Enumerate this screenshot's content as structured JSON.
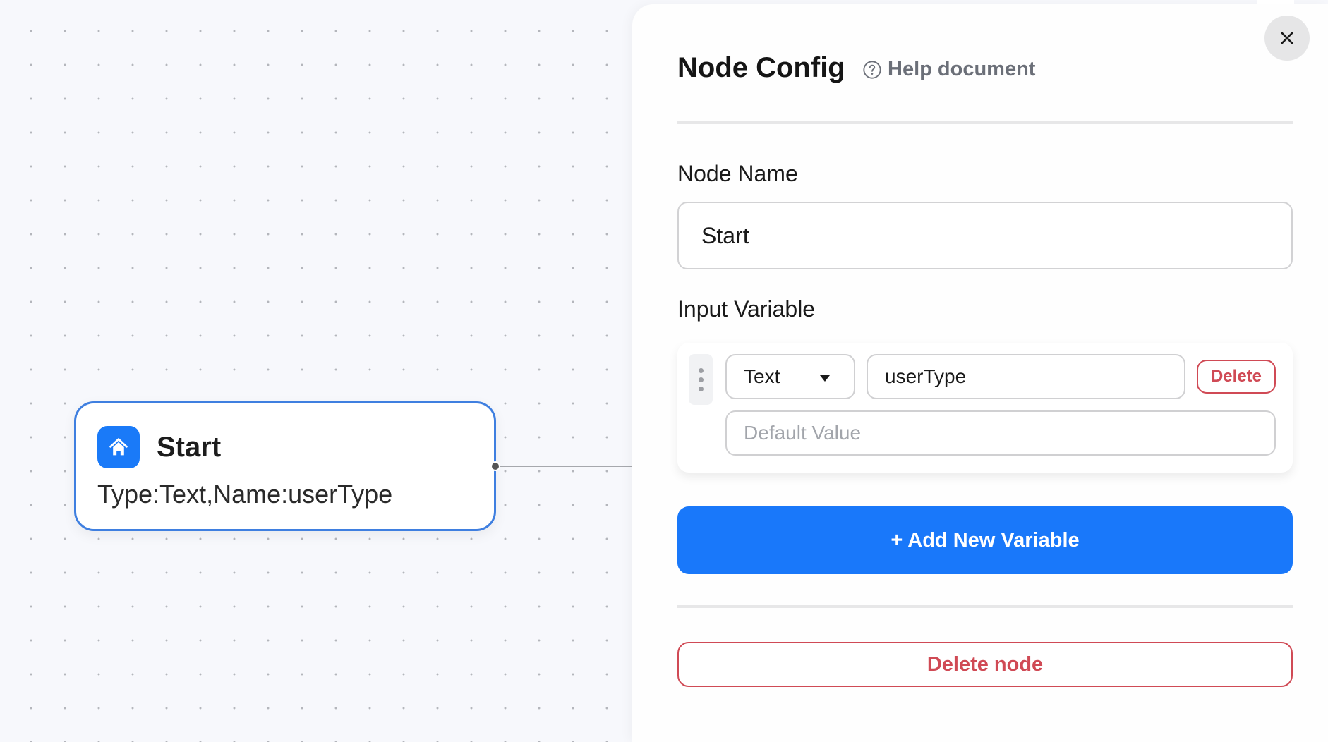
{
  "canvas": {
    "node": {
      "icon": "home-icon",
      "title": "Start",
      "description": "Type:Text,Name:userType"
    }
  },
  "panel": {
    "title": "Node Config",
    "help_icon": "question-circle-icon",
    "help_label": "Help document",
    "close_icon": "close-icon",
    "node_name_label": "Node Name",
    "node_name_value": "Start",
    "input_variable_label": "Input Variable",
    "variables": [
      {
        "type": "Text",
        "name": "userType",
        "default_value": "",
        "default_placeholder": "Default Value",
        "delete_label": "Delete"
      }
    ],
    "add_variable_label": "+ Add New Variable",
    "delete_node_label": "Delete node"
  },
  "colors": {
    "accent": "#1978fa",
    "danger": "#d04a55",
    "node_border": "#3f7fe0"
  }
}
